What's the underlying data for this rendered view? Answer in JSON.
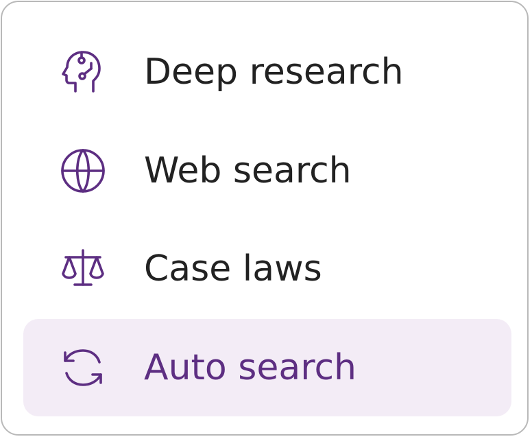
{
  "menu": {
    "accent_color": "#5d2e82",
    "selected_bg": "#f3ecf6",
    "items": [
      {
        "label": "Deep research",
        "icon": "brain-head-icon",
        "selected": false
      },
      {
        "label": "Web search",
        "icon": "globe-icon",
        "selected": false
      },
      {
        "label": "Case laws",
        "icon": "scales-icon",
        "selected": false
      },
      {
        "label": "Auto search",
        "icon": "refresh-arrows-icon",
        "selected": true
      }
    ]
  }
}
